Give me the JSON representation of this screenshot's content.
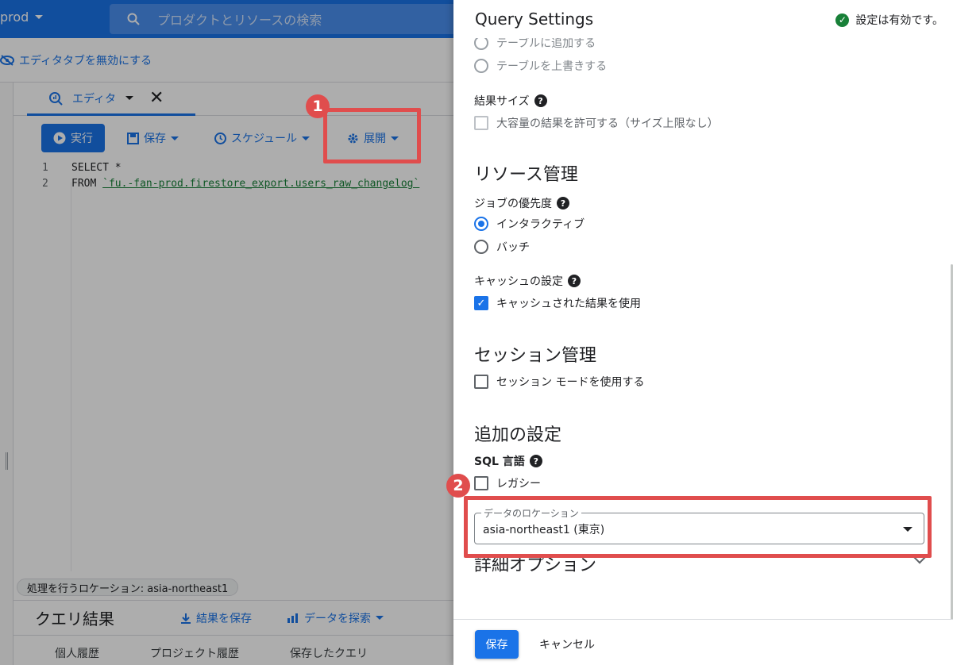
{
  "workspace": {
    "project_label": "prod",
    "search_placeholder": "プロダクトとリソースの検索",
    "disable_tab_label": "エディタタブを無効にする",
    "editor_tab_label": "エディタ",
    "toolbar": {
      "run_label": "実行",
      "save_label": "保存",
      "schedule_label": "スケジュール",
      "expand_label": "展開"
    },
    "code_lines": [
      {
        "num": "1",
        "text": "SELECT *"
      },
      {
        "num": "2",
        "keyword": "FROM",
        "table": "`fu.-fan-prod.firestore_export.users_raw_changelog`"
      }
    ],
    "location_chip": "処理を行うロケーション: asia-northeast1",
    "results": {
      "title": "クエリ結果",
      "save_results": "結果を保存",
      "explore_data": "データを探索"
    },
    "history_tabs": [
      "個人履歴",
      "プロジェクト履歴",
      "保存したクエリ"
    ]
  },
  "annotations": {
    "marker_1": "1",
    "marker_2": "2",
    "color": "#e04d4d"
  },
  "panel": {
    "title": "Query Settings",
    "status_text": "設定は有効です。",
    "destination_options": {
      "append_label": "テーブルに追加する",
      "overwrite_label": "テーブルを上書きする"
    },
    "result_size": {
      "label": "結果サイズ",
      "allow_large_label": "大容量の結果を許可する（サイズ上限なし）"
    },
    "resource_heading": "リソース管理",
    "job_priority": {
      "label": "ジョブの優先度",
      "interactive_label": "インタラクティブ",
      "batch_label": "バッチ",
      "selected": "interactive"
    },
    "cache": {
      "label": "キャッシュの設定",
      "use_cache_label": "キャッシュされた結果を使用",
      "checked": true
    },
    "session_heading": "セッション管理",
    "session_mode_label": "セッション モードを使用する",
    "additional_heading": "追加の設定",
    "sql_dialect": {
      "label": "SQL 言語",
      "legacy_label": "レガシー"
    },
    "data_location": {
      "legend": "データのロケーション",
      "value": "asia-northeast1 (東京)"
    },
    "advanced_options_label": "詳細オプション",
    "footer": {
      "save_label": "保存",
      "cancel_label": "キャンセル"
    }
  },
  "colors": {
    "primary": "#1a73e8",
    "success": "#188038",
    "annotation": "#e04d4d"
  }
}
